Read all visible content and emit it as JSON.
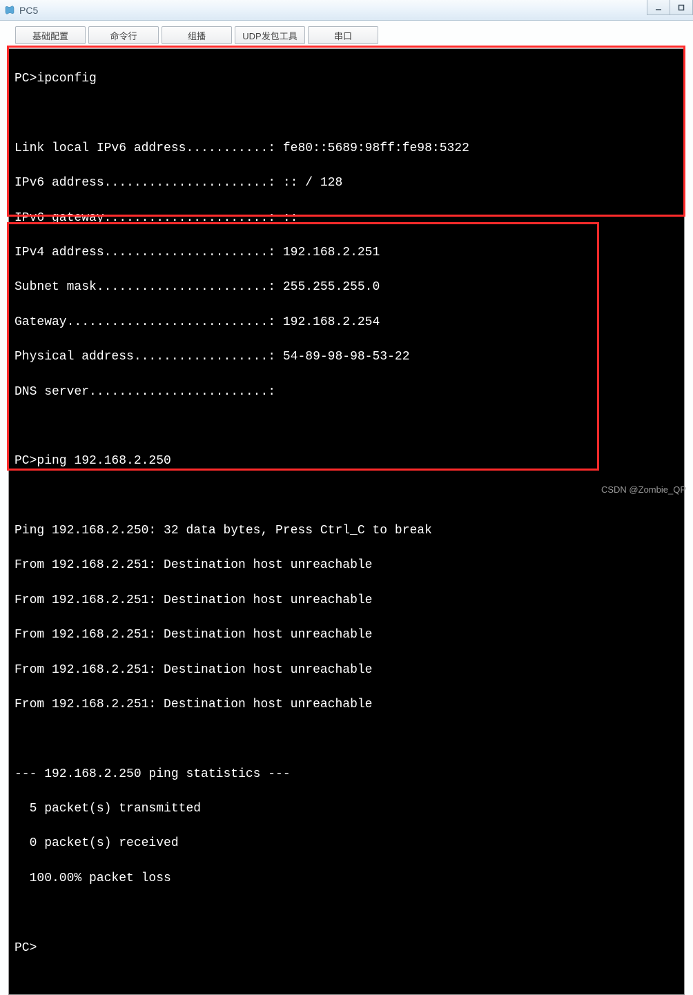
{
  "window": {
    "title": "PC5"
  },
  "tabs": {
    "t0": "基础配置",
    "t1": "命令行",
    "t2": "组播",
    "t3": "UDP发包工具",
    "t4": "串口"
  },
  "terminal": {
    "l0": "PC>ipconfig",
    "l1": "",
    "l2": "Link local IPv6 address...........: fe80::5689:98ff:fe98:5322",
    "l3": "IPv6 address......................: :: / 128",
    "l4": "IPv6 gateway......................: ::",
    "l5": "IPv4 address......................: 192.168.2.251",
    "l6": "Subnet mask.......................: 255.255.255.0",
    "l7": "Gateway...........................: 192.168.2.254",
    "l8": "Physical address..................: 54-89-98-98-53-22",
    "l9": "DNS server........................:",
    "l10": "",
    "l11": "PC>ping 192.168.2.250",
    "l12": "",
    "l13": "Ping 192.168.2.250: 32 data bytes, Press Ctrl_C to break",
    "l14": "From 192.168.2.251: Destination host unreachable",
    "l15": "From 192.168.2.251: Destination host unreachable",
    "l16": "From 192.168.2.251: Destination host unreachable",
    "l17": "From 192.168.2.251: Destination host unreachable",
    "l18": "From 192.168.2.251: Destination host unreachable",
    "l19": "",
    "l20": "--- 192.168.2.250 ping statistics ---",
    "l21": "  5 packet(s) transmitted",
    "l22": "  0 packet(s) received",
    "l23": "  100.00% packet loss",
    "l24": "",
    "l25": "PC>"
  },
  "watermark": "CSDN @Zombie_QP"
}
